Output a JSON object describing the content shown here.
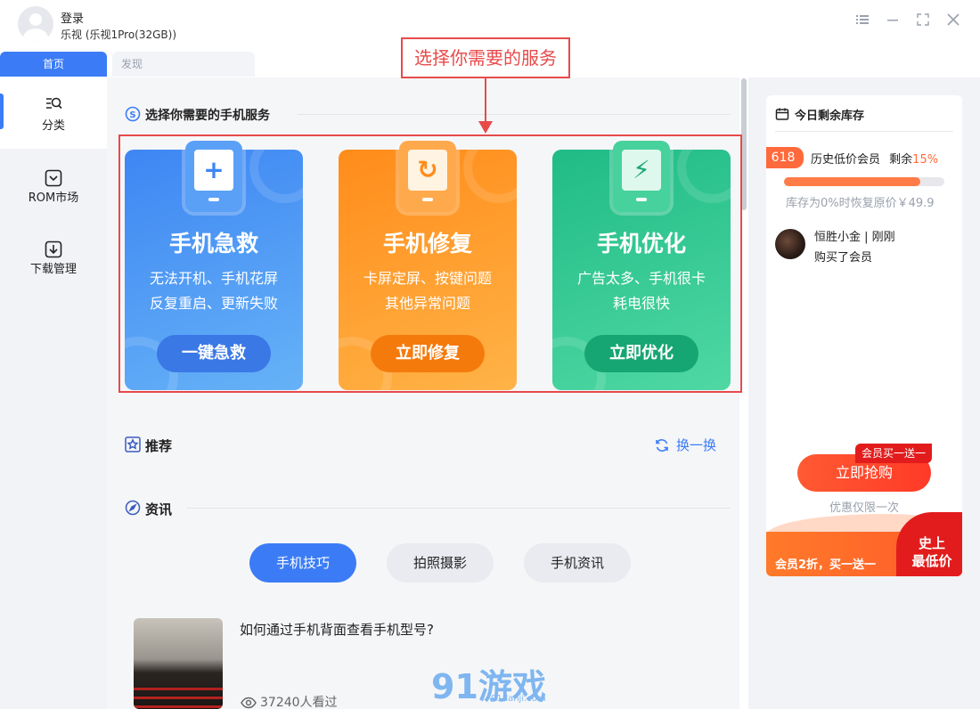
{
  "header": {
    "login_label": "登录",
    "device_label": "乐视 (乐视1Pro(32GB))",
    "controls": [
      "menu-icon",
      "minimize-icon",
      "maximize-icon",
      "close-icon"
    ]
  },
  "tabs": [
    {
      "label": "首页",
      "active": true
    },
    {
      "label": "发现",
      "active": false
    }
  ],
  "sidebar": {
    "items": [
      {
        "label": "分类",
        "icon": "category-icon",
        "active": true
      },
      {
        "label": "ROM市场",
        "icon": "rom-market-icon",
        "active": false
      },
      {
        "label": "下载管理",
        "icon": "download-icon",
        "active": false
      }
    ]
  },
  "main": {
    "services_title": "选择你需要的手机服务",
    "cards": [
      {
        "title": "手机急救",
        "desc_line1": "无法开机、手机花屏",
        "desc_line2": "反复重启、更新失败",
        "button": "一键急救",
        "icon_glyph": "+",
        "color": "#4a8ff5"
      },
      {
        "title": "手机修复",
        "desc_line1": "卡屏定屏、按键问题",
        "desc_line2": "其他异常问题",
        "button": "立即修复",
        "icon_glyph": "↻",
        "color": "#ff9628"
      },
      {
        "title": "手机优化",
        "desc_line1": "广告太多、手机很卡",
        "desc_line2": "耗电很快",
        "button": "立即优化",
        "icon_glyph": "⚡",
        "color": "#2fc28f"
      }
    ],
    "recommend_title": "推荐",
    "refresh_label": "换一换",
    "news_title": "资讯",
    "news_tabs": [
      {
        "label": "手机技巧",
        "active": true
      },
      {
        "label": "拍照摄影",
        "active": false
      },
      {
        "label": "手机资讯",
        "active": false
      }
    ],
    "news_item": {
      "title": "如何通过手机背面查看手机型号?",
      "views": "37240人看过"
    },
    "watermark": "91游戏",
    "watermark_sub": "91danji.com"
  },
  "annotation": {
    "label": "选择你需要的服务"
  },
  "right_panel": {
    "title": "今日剩余库存",
    "badge": "618",
    "vip_label": "历史低价会员",
    "remain_label": "剩余",
    "remain_percent": "15%",
    "stock_progress": 0.85,
    "restore_note": "库存为0%时恢复原价￥49.9",
    "buyer_name": "恒胜小金 | 刚刚",
    "buyer_action": "购买了会员",
    "promo_tag": "会员买一送一",
    "buy_button": "立即抢购",
    "limited_note": "优惠仅限一次",
    "banner_text": "会员2折，买一送一",
    "banner_low_line1": "史上",
    "banner_low_line2": "最低价"
  }
}
